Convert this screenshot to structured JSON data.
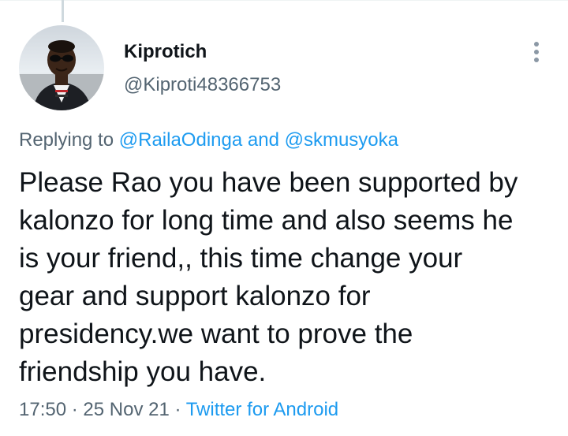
{
  "tweet": {
    "author": {
      "name": "Kiprotich",
      "handle": "@Kiproti48366753",
      "avatar_icon": "profile-photo"
    },
    "reply": {
      "prefix": "Replying to",
      "user1": "@RailaOdinga",
      "connector": "and",
      "user2": "@skmusyoka"
    },
    "text_lines": [
      "Please Rao you have been supported by",
      "kalonzo for long time and also seems he",
      "is your friend,, this time change your",
      "gear and support kalonzo for",
      "presidency.we want to prove the",
      "friendship you have."
    ],
    "meta": {
      "time": "17:50",
      "sep1": "·",
      "date": "25 Nov 21",
      "sep2": "·",
      "source": "Twitter for Android"
    },
    "more_icon": "more-options-icon"
  },
  "colors": {
    "primary_text": "#0f1419",
    "secondary_text": "#536471",
    "link": "#1d9bf0",
    "thread_line": "#cfd9de"
  }
}
